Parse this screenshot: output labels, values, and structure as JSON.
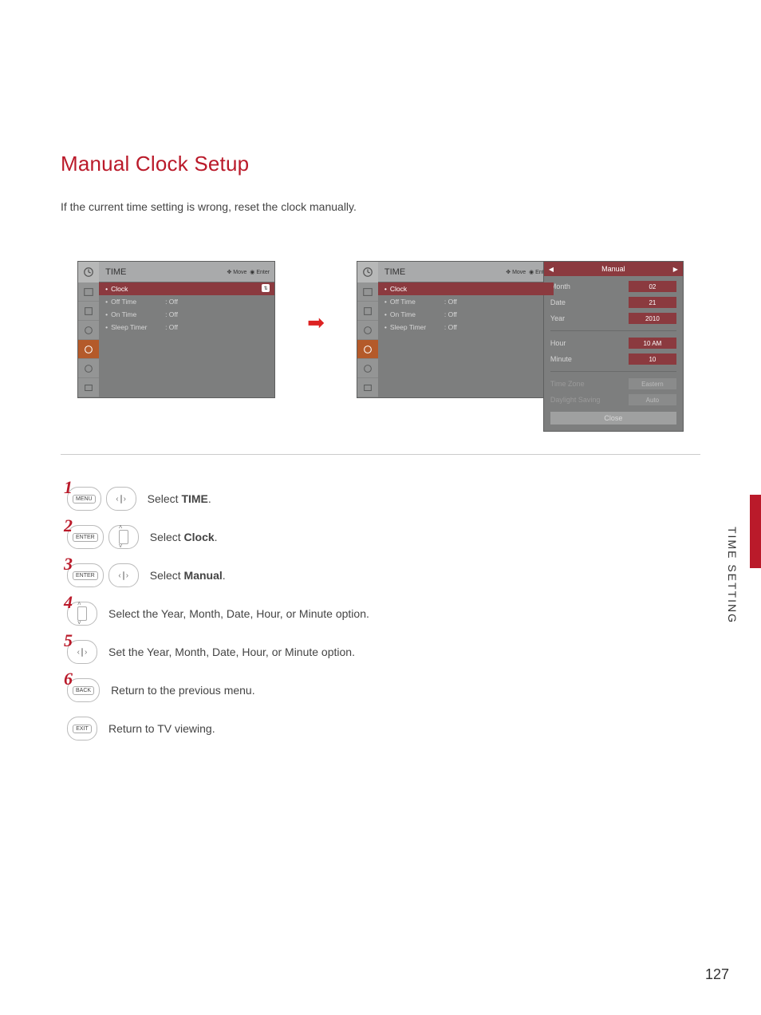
{
  "heading": "Manual Clock Setup",
  "intro": "If the current time setting is wrong, reset the clock manually.",
  "side_label": "TIME SETTING",
  "page_number": "127",
  "osd": {
    "title": "TIME",
    "hints_move": "Move",
    "hints_enter": "Enter",
    "items": [
      {
        "label": "Clock",
        "value": "",
        "selected": true
      },
      {
        "label": "Off Time",
        "value": ": Off",
        "selected": false
      },
      {
        "label": "On Time",
        "value": ": Off",
        "selected": false
      },
      {
        "label": "Sleep Timer",
        "value": ": Off",
        "selected": false
      }
    ]
  },
  "popup": {
    "title": "Manual",
    "rows": [
      {
        "label": "Month",
        "value": "02"
      },
      {
        "label": "Date",
        "value": "21"
      },
      {
        "label": "Year",
        "value": "2010"
      }
    ],
    "rows2": [
      {
        "label": "Hour",
        "value": "10 AM"
      },
      {
        "label": "Minute",
        "value": "10"
      }
    ],
    "rows_dim": [
      {
        "label": "Time Zone",
        "value": "Eastern"
      },
      {
        "label": "Daylight Saving",
        "value": "Auto"
      }
    ],
    "close": "Close"
  },
  "steps": {
    "s1": {
      "btn": "MENU",
      "text_pre": "Select ",
      "text_b": "TIME",
      "text_post": "."
    },
    "s2": {
      "btn": "ENTER",
      "text_pre": "Select ",
      "text_b": "Clock",
      "text_post": "."
    },
    "s3": {
      "btn": "ENTER",
      "text_pre": "Select ",
      "text_b": "Manual",
      "text_post": "."
    },
    "s4": {
      "text": "Select the Year, Month, Date, Hour, or Minute option."
    },
    "s5": {
      "text": "Set the Year, Month, Date, Hour, or Minute option."
    },
    "s6": {
      "btn": "BACK",
      "text": "Return to the previous menu."
    },
    "s7": {
      "btn": "EXIT",
      "text": "Return to TV viewing."
    }
  }
}
